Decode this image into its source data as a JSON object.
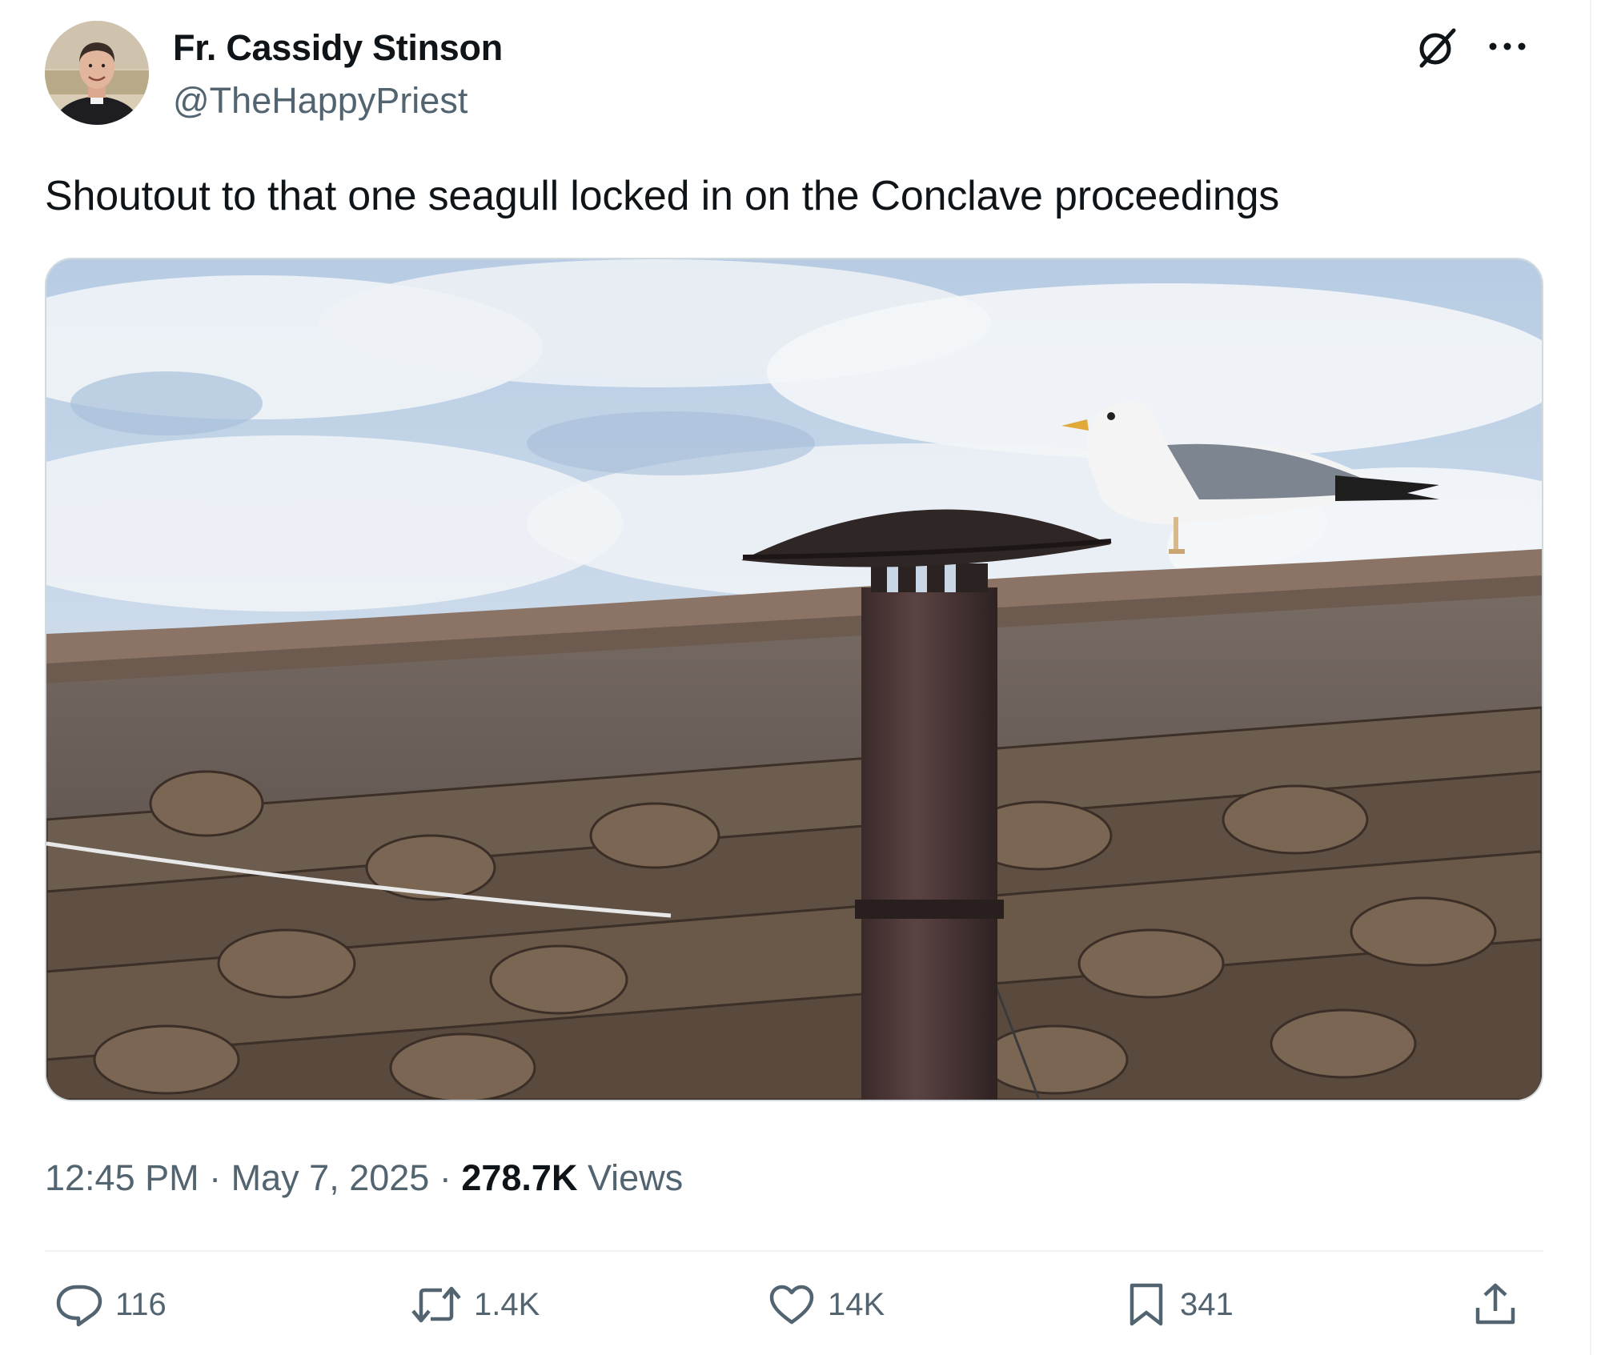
{
  "author": {
    "name": "Fr. Cassidy Stinson",
    "handle": "@TheHappyPriest"
  },
  "header_icons": [
    "grok-icon",
    "more-icon"
  ],
  "tweet": {
    "text": "Shoutout to that one seagull locked in on the Conclave proceedings"
  },
  "meta": {
    "time": "12:45 PM",
    "separator": "·",
    "date": "May 7, 2025",
    "views_count": "278.7K",
    "views_label": "Views"
  },
  "actions": {
    "replies": "116",
    "reposts": "1.4K",
    "likes": "14K",
    "bookmarks": "341"
  },
  "action_icons": [
    "reply-icon",
    "retweet-icon",
    "like-icon",
    "bookmark-icon",
    "share-icon"
  ],
  "colors": {
    "text_primary": "#0f1419",
    "text_secondary": "#536471",
    "border": "#cfd9de"
  }
}
